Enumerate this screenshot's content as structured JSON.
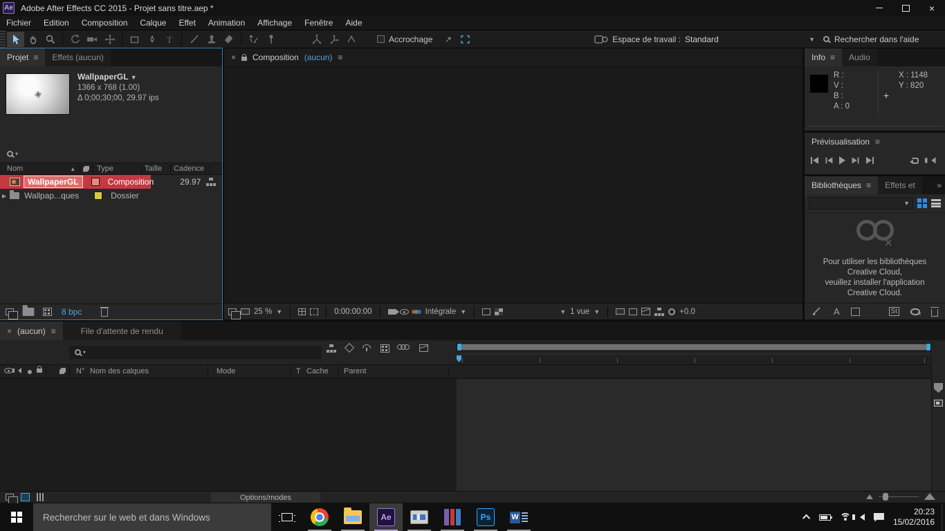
{
  "icons": {
    "menu": "≡",
    "close": "×",
    "caret_down": "▼",
    "caret_small": "▾",
    "caret_right": "▶",
    "sort_asc": "▲",
    "chevrons_right": "»",
    "plus": "+",
    "arrow_ne": "↗"
  },
  "window": {
    "title": "Adobe After Effects CC 2015 - Projet sans titre.aep *",
    "app_badge": "Ae"
  },
  "menu": {
    "items": [
      "Fichier",
      "Edition",
      "Composition",
      "Calque",
      "Effet",
      "Animation",
      "Affichage",
      "Fenêtre",
      "Aide"
    ]
  },
  "toolbar": {
    "tools": [
      "selection",
      "hand",
      "zoom",
      "rotation",
      "camera",
      "pan-behind",
      "rectangle",
      "pen",
      "type",
      "brush",
      "clone-stamp",
      "eraser",
      "roto-brush",
      "puppet-pin",
      "axis-local",
      "axis-world",
      "axis-view"
    ],
    "snap_label": "Accrochage",
    "workspace_label": "Espace de travail :",
    "workspace_value": "Standard",
    "help_search_placeholder": "Rechercher dans l'aide"
  },
  "project": {
    "tab": "Projet",
    "tab_effects": "Effets  (aucun)",
    "item_name": "WallpaperGL",
    "item_dims": "1366 x 768 (1.00)",
    "item_time": "Δ 0;00;30;00, 29.97 ips",
    "columns": {
      "name": "Nom",
      "type": "Type",
      "size": "Taille",
      "rate": "Cadence"
    },
    "rows": [
      {
        "name": "WallpaperGL",
        "type": "Composition",
        "rate": "29.97"
      },
      {
        "name": "Wallpap...ques",
        "type": "Dossier",
        "rate": ""
      }
    ],
    "bpc": "8 bpc"
  },
  "viewer": {
    "tab": "Composition",
    "tab_state": "(aucun)",
    "zoom": "25 %",
    "timecode": "0:00:00:00",
    "resolution": "Intégrale",
    "views": "1 vue",
    "exposure": "+0.0"
  },
  "info": {
    "tab": "Info",
    "tab_audio": "Audio",
    "r": "R :",
    "g": "V :",
    "b": "B :",
    "a": "A : 0",
    "x": "X : 1148",
    "y": "Y : 820"
  },
  "preview": {
    "title": "Prévisualisation"
  },
  "libraries": {
    "tab": "Bibliothèques",
    "tab_effects": "Effets et",
    "message": "Pour utiliser les bibliothèques Creative Cloud,\nveuillez installer l'application Creative Cloud.",
    "st_badge": "St",
    "font_badge": "A"
  },
  "timeline": {
    "tab": "(aucun)",
    "tab_render": "File d'attente de rendu",
    "columns": {
      "num": "N°",
      "layer_name": "Nom des calques",
      "mode": "Mode",
      "t": "T",
      "cache": "Cache",
      "parent": "Parent"
    },
    "options_button": "Options/modes"
  },
  "taskbar": {
    "search_placeholder": "Rechercher sur le web et dans Windows",
    "apps": [
      "task-view",
      "chrome",
      "file-explorer",
      "after-effects",
      "media-app",
      "winrar",
      "photoshop",
      "word"
    ],
    "ae_badge": "Ae",
    "ps_badge": "Ps",
    "word_badge": "W",
    "time": "20:23",
    "date": "15/02/2016"
  },
  "colors": {
    "accent_blue": "#3fa8e0",
    "text_blue": "#55a4d8",
    "selection_red": "#c43841",
    "label_salmon": "#e8897d",
    "label_yellow": "#d8c83d",
    "cc_blue": "#2d8ceb"
  }
}
